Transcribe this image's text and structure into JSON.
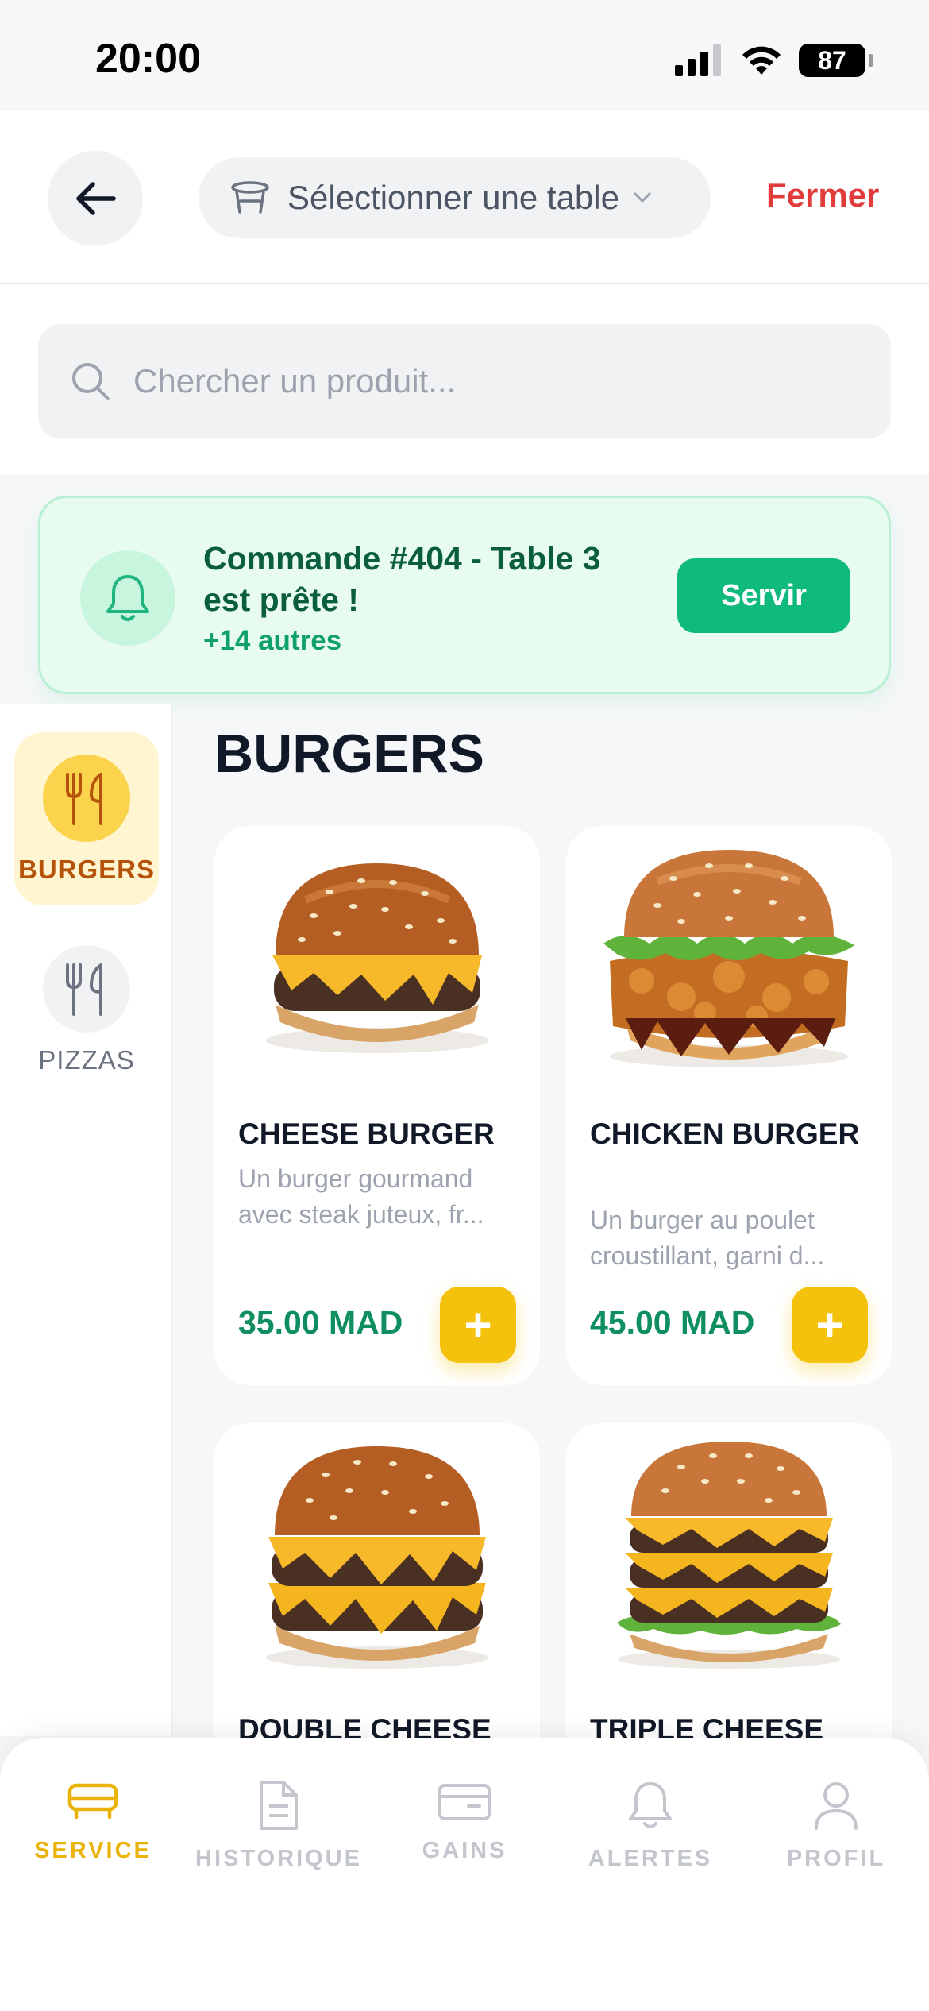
{
  "status": {
    "time": "20:00",
    "battery": "87"
  },
  "header": {
    "table_select_label": "Sélectionner une table",
    "close_label": "Fermer"
  },
  "search": {
    "placeholder": "Chercher un produit..."
  },
  "notification": {
    "title": "Commande #404 - Table 3 est prête !",
    "subtitle": "+14 autres",
    "action_label": "Servir"
  },
  "categories": [
    {
      "label": "BURGERS",
      "active": true
    },
    {
      "label": "PIZZAS",
      "active": false
    }
  ],
  "section": {
    "title": "BURGERS"
  },
  "products": [
    {
      "name": "CHEESE BURGER",
      "desc": "Un burger gourmand avec steak juteux, fr...",
      "price": "35.00 MAD",
      "add_label": "+"
    },
    {
      "name": "CHICKEN BURGER",
      "desc": "Un burger au poulet croustillant, garni d...",
      "price": "45.00 MAD",
      "add_label": "+"
    },
    {
      "name": "DOUBLE CHEESE",
      "desc": "",
      "price": "",
      "add_label": ""
    },
    {
      "name": "TRIPLE CHEESE",
      "desc": "",
      "price": "",
      "add_label": ""
    }
  ],
  "nav": [
    {
      "label": "SERVICE",
      "icon": "sofa-icon",
      "active": true
    },
    {
      "label": "HISTORIQUE",
      "icon": "document-icon",
      "active": false
    },
    {
      "label": "GAINS",
      "icon": "wallet-icon",
      "active": false
    },
    {
      "label": "ALERTES",
      "icon": "bell-icon",
      "active": false
    },
    {
      "label": "PROFIL",
      "icon": "user-icon",
      "active": false
    }
  ],
  "colors": {
    "accent": "#f4c20d",
    "success": "#10b97c",
    "danger": "#e23b3b",
    "price": "#0f8f5f"
  }
}
